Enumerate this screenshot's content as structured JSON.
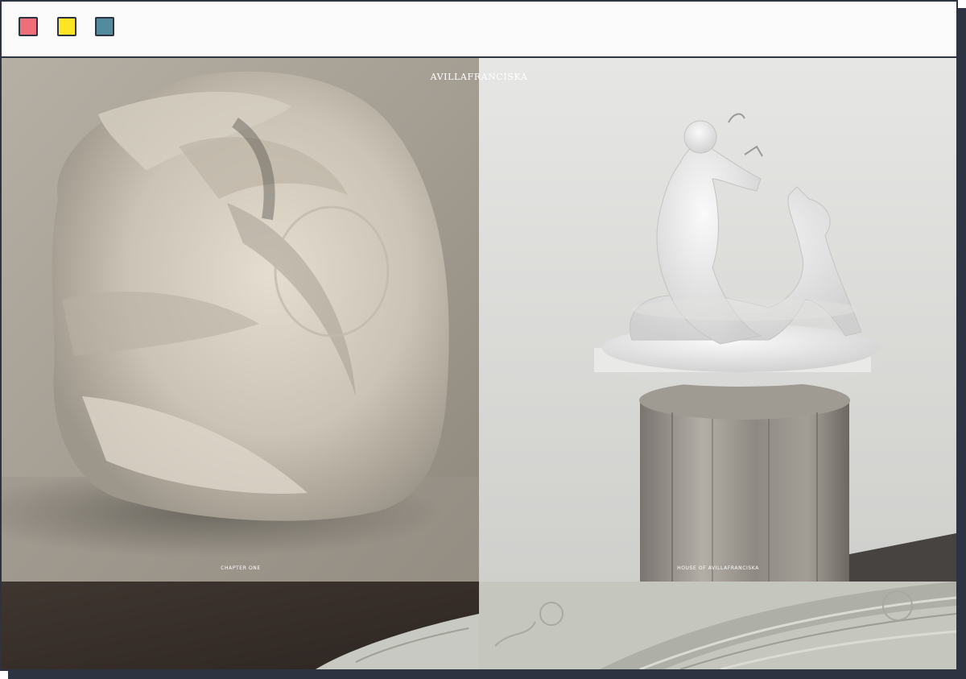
{
  "window": {
    "controls": [
      {
        "name": "close",
        "color": "#ee6f7a"
      },
      {
        "name": "minimize",
        "color": "#fde524"
      },
      {
        "name": "maximize",
        "color": "#548b9c"
      }
    ],
    "frame_color": "#2d3340"
  },
  "site": {
    "brand": "AVILLAFRANCISKA"
  },
  "gallery": {
    "left_caption": "CHAPTER ONE",
    "right_caption": "HOUSE OF AVILLAFRANCISKA"
  },
  "images": {
    "left": "draped-leather-bag-photo",
    "right": "porcelain-figurine-on-wood-pedestal-photo",
    "bottom_left": "dark-brown-fabric-photo",
    "bottom_right": "jacquard-fabric-photo"
  }
}
